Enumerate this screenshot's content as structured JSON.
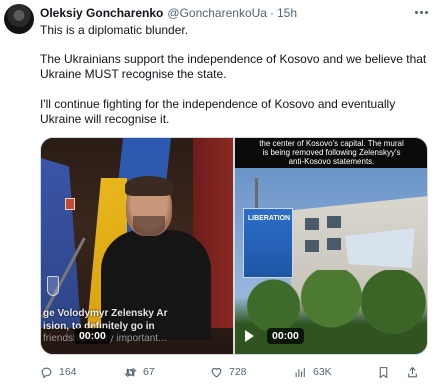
{
  "tweet": {
    "author_name": "Oleksiy Goncharenko",
    "handle": "@GoncharenkoUa",
    "separator": "·",
    "time": "15h",
    "text_line1": "This is a diplomatic blunder.",
    "text_para2": "The Ukrainians support the independence of Kosovo and we believe that Ukraine MUST recognise the state.",
    "text_para3": "I'll continue fighting for the independence of Kosovo and eventually Ukraine will recognise it."
  },
  "media": {
    "video1": {
      "subtitle_line1": "ge Volodymyr Zelensky Ar",
      "subtitle_line2": "ision, to definitely go in",
      "subtitle_line3": "friendship...very important...",
      "duration": "00:00"
    },
    "video2": {
      "caption_line1": "the center of Kosovo's capital. The mural",
      "caption_line2": "is being removed following Zelenskyy's",
      "caption_line3": "anti-Kosovo statements.",
      "billboard_text": "LIBERATION",
      "duration": "00:00"
    }
  },
  "actions": {
    "replies": "164",
    "retweets": "67",
    "likes": "728",
    "views": "63K"
  },
  "colors": {
    "text": "#0f1419",
    "secondary": "#536471",
    "border": "#cfd9de"
  }
}
